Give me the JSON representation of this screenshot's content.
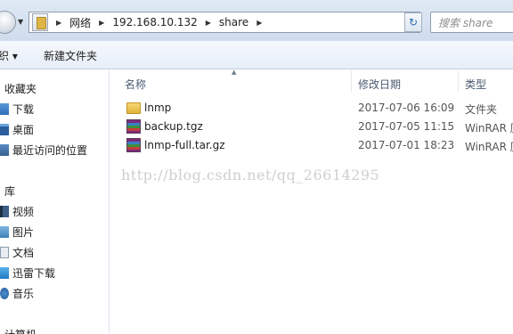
{
  "address_bar": {
    "crumbs": [
      "网络",
      "192.168.10.132",
      "share"
    ],
    "search_placeholder": "搜索 share"
  },
  "command_bar": {
    "organize_label": "织 ▾",
    "new_folder_label": "新建文件夹"
  },
  "nav_pane": {
    "favorites_header": "收藏夹",
    "favorites": [
      {
        "label": "下载",
        "icon": "download-icon"
      },
      {
        "label": "桌面",
        "icon": "desktop-icon"
      },
      {
        "label": "最近访问的位置",
        "icon": "recent-places-icon"
      }
    ],
    "libraries_header": "库",
    "libraries": [
      {
        "label": "视频",
        "icon": "video-icon"
      },
      {
        "label": "图片",
        "icon": "pictures-icon"
      },
      {
        "label": "文档",
        "icon": "documents-icon"
      },
      {
        "label": "迅雷下载",
        "icon": "thunder-download-icon"
      },
      {
        "label": "音乐",
        "icon": "music-icon"
      }
    ],
    "computer_header": "计算机"
  },
  "file_list": {
    "columns": {
      "name": "名称",
      "date": "修改日期",
      "type": "类型"
    },
    "rows": [
      {
        "name": "lnmp",
        "date": "2017-07-06 16:09",
        "type": "文件夹",
        "icon": "folder-icon"
      },
      {
        "name": "backup.tgz",
        "date": "2017-07-05 11:15",
        "type": "WinRAR 压",
        "icon": "winrar-archive-icon"
      },
      {
        "name": "lnmp-full.tar.gz",
        "date": "2017-07-01 18:23",
        "type": "WinRAR 压",
        "icon": "winrar-archive-icon"
      }
    ]
  },
  "watermark": "http://blog.csdn.net/qq_26614295"
}
